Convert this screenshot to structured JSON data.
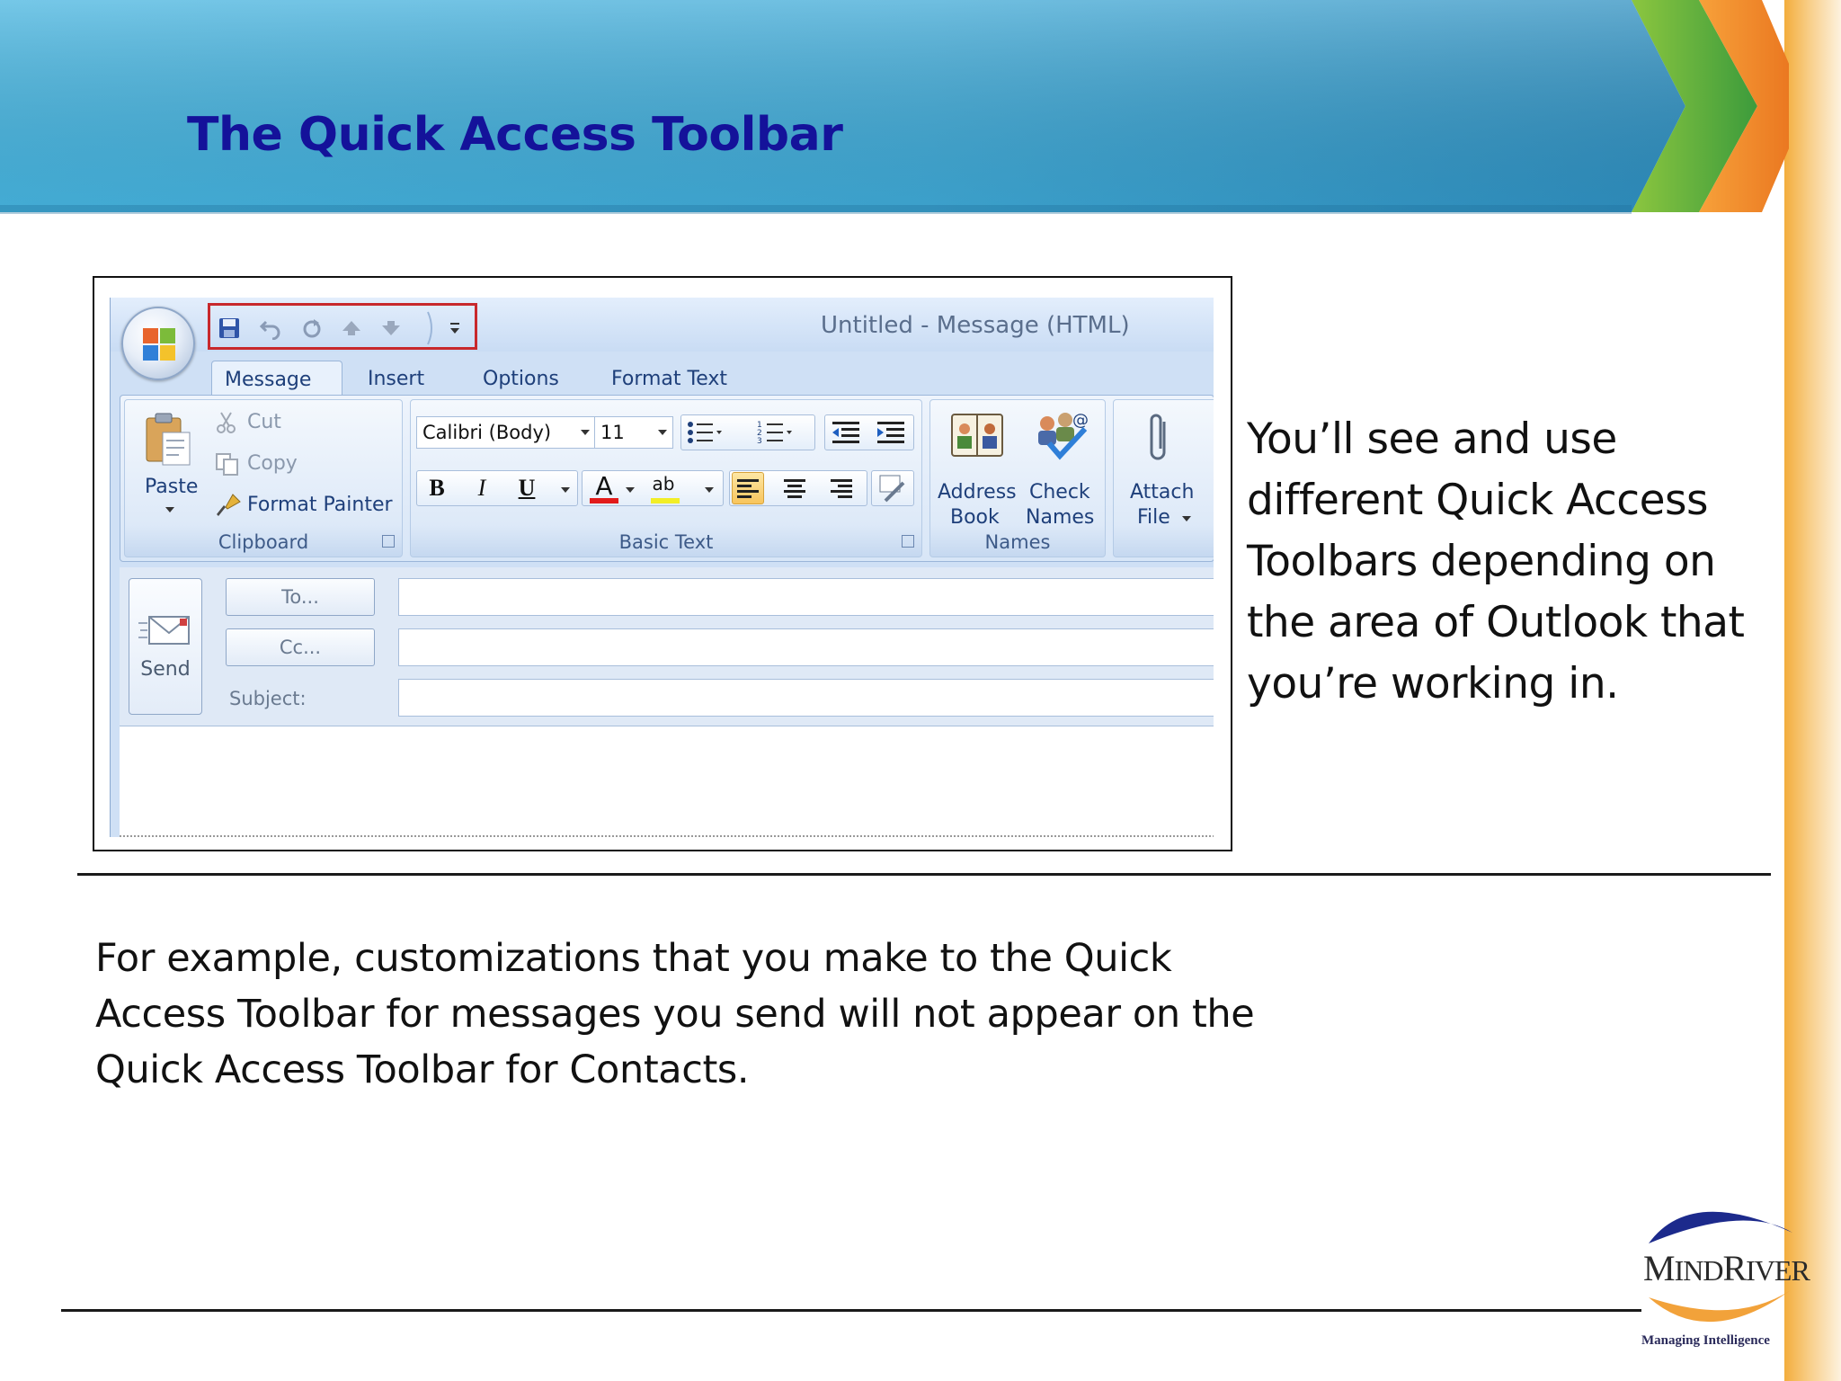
{
  "slide": {
    "title": "The Quick Access Toolbar",
    "side_text": "You’ll see and use different Quick Access Toolbars depending on the area of Outlook that you’re working in.",
    "bottom_text": "For example, customizations that you make to the Quick Access Toolbar for messages you send will not appear on the Quick Access Toolbar for Contacts.",
    "logo": {
      "name_big1": "M",
      "name_small1": "IND",
      "name_big2": "R",
      "name_small2": "IVER",
      "tagline": "Managing Intelligence"
    }
  },
  "window": {
    "title": "Untitled - Message (HTML)",
    "qat_icons": [
      "save-icon",
      "undo-icon",
      "redo-icon",
      "previous-item-icon",
      "next-item-icon",
      "customize-qat-icon"
    ],
    "tabs": [
      {
        "label": "Message",
        "active": true
      },
      {
        "label": "Insert"
      },
      {
        "label": "Options"
      },
      {
        "label": "Format Text"
      }
    ]
  },
  "ribbon": {
    "clipboard": {
      "label": "Clipboard",
      "paste": "Paste",
      "cut": "Cut",
      "copy": "Copy",
      "format_painter": "Format Painter"
    },
    "basic_text": {
      "label": "Basic Text",
      "font": "Calibri (Body)",
      "size": "11",
      "bold": "B",
      "italic": "I",
      "underline": "U",
      "font_color": "A",
      "highlight": "ab"
    },
    "names": {
      "label": "Names",
      "address_book_1": "Address",
      "address_book_2": "Book",
      "check_names_1": "Check",
      "check_names_2": "Names"
    },
    "include": {
      "attach_1": "Attach",
      "attach_2": "File"
    }
  },
  "message": {
    "send": "Send",
    "to": "To...",
    "cc": "Cc...",
    "subject_label": "Subject:"
  },
  "colors": {
    "title": "#14129a",
    "qat_highlight": "#c8282c",
    "ribbon_text": "#1e3f7a"
  }
}
